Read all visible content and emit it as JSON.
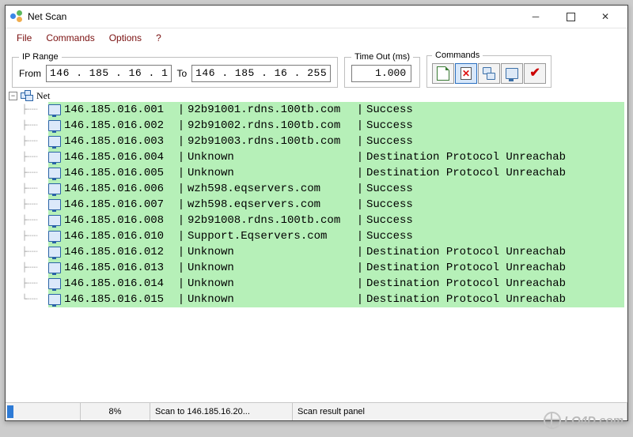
{
  "window": {
    "title": "Net Scan"
  },
  "menu": {
    "file": "File",
    "commands": "Commands",
    "options": "Options",
    "help": "?"
  },
  "iprange": {
    "legend": "IP Range",
    "from_label": "From",
    "from_value": "146 . 185 .  16  .   1",
    "to_label": "To",
    "to_value": "146 . 185 .  16  . 255"
  },
  "timeout": {
    "legend": "Time Out (ms)",
    "value": "1.000"
  },
  "commands": {
    "legend": "Commands"
  },
  "tree": {
    "root_label": "Net",
    "entries": [
      {
        "ip": "146.185.016.001",
        "host": "92b91001.rdns.100tb.com",
        "status": "Success"
      },
      {
        "ip": "146.185.016.002",
        "host": "92b91002.rdns.100tb.com",
        "status": "Success"
      },
      {
        "ip": "146.185.016.003",
        "host": "92b91003.rdns.100tb.com",
        "status": "Success"
      },
      {
        "ip": "146.185.016.004",
        "host": "Unknown",
        "status": "Destination Protocol Unreachab"
      },
      {
        "ip": "146.185.016.005",
        "host": "Unknown",
        "status": "Destination Protocol Unreachab"
      },
      {
        "ip": "146.185.016.006",
        "host": "wzh598.eqservers.com",
        "status": "Success"
      },
      {
        "ip": "146.185.016.007",
        "host": "wzh598.eqservers.com",
        "status": "Success"
      },
      {
        "ip": "146.185.016.008",
        "host": "92b91008.rdns.100tb.com",
        "status": "Success"
      },
      {
        "ip": "146.185.016.010",
        "host": "Support.Eqservers.com",
        "status": "Success"
      },
      {
        "ip": "146.185.016.012",
        "host": "Unknown",
        "status": "Destination Protocol Unreachab"
      },
      {
        "ip": "146.185.016.013",
        "host": "Unknown",
        "status": "Destination Protocol Unreachab"
      },
      {
        "ip": "146.185.016.014",
        "host": "Unknown",
        "status": "Destination Protocol Unreachab"
      },
      {
        "ip": "146.185.016.015",
        "host": "Unknown",
        "status": "Destination Protocol Unreachab"
      }
    ]
  },
  "status": {
    "progress_pct": 8,
    "pct_label": "8%",
    "scan_label": "Scan to 146.185.16.20...",
    "panel_label": "Scan result panel"
  },
  "watermark": "LO4D.com"
}
